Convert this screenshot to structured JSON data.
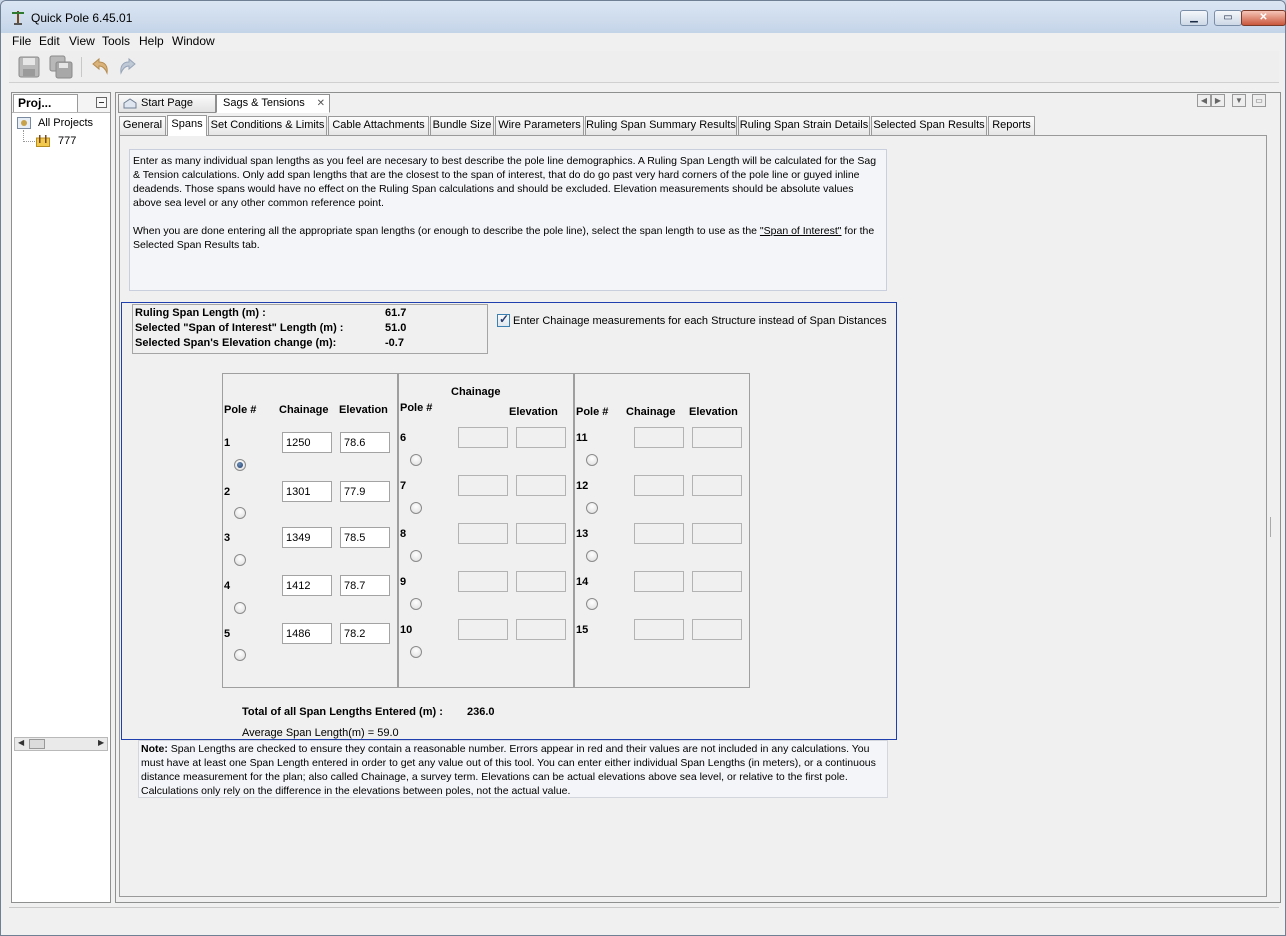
{
  "window": {
    "title": "Quick Pole 6.45.01"
  },
  "menu": [
    "File",
    "Edit",
    "View",
    "Tools",
    "Help",
    "Window"
  ],
  "projects_panel": {
    "tab_label": "Proj...",
    "tree": [
      {
        "label": "All Projects"
      },
      {
        "label": "777"
      }
    ]
  },
  "doc_tabs": [
    {
      "label": "Start Page"
    },
    {
      "label": "Sags & Tensions"
    }
  ],
  "sub_tabs": [
    "General",
    "Spans",
    "Set Conditions & Limits",
    "Cable Attachments",
    "Bundle Size",
    "Wire Parameters",
    "Ruling Span Summary Results",
    "Ruling Span Strain Details",
    "Selected Span Results",
    "Reports"
  ],
  "intro": {
    "para1": "Enter as many individual span lengths as you feel are necesary to best describe the pole line demographics. A Ruling Span Length will be calculated for the Sag & Tension calculations. Only add span lengths that are the closest to the span of interest, that do do go past very hard corners of the pole line or guyed inline deadends. Those spans would have no effect on the Ruling Span calculations and should be excluded. Elevation measurements should be absolute values above sea level or any other common reference point.",
    "para2_before": "When you are done entering all the appropriate span lengths (or enough to describe the pole line), select the span length to use as the ",
    "para2_link": "\"Span of Interest\"",
    "para2_after": " for the Selected Span Results tab."
  },
  "summary": {
    "ruling_label": "Ruling Span Length (m) :",
    "ruling_value": "61.7",
    "selected_label": "Selected \"Span of Interest\" Length (m) :",
    "selected_value": "51.0",
    "elev_label": "Selected Span's Elevation change (m):",
    "elev_value": "-0.7"
  },
  "chainage_checkbox": {
    "label": "Enter Chainage measurements for each Structure instead of Span Distances",
    "checked": true
  },
  "headers": {
    "pole": "Pole #",
    "chainage": "Chainage",
    "elevation": "Elevation"
  },
  "poles": [
    {
      "num": "1",
      "chainage": "1250",
      "elevation": "78.6",
      "selected": true
    },
    {
      "num": "2",
      "chainage": "1301",
      "elevation": "77.9"
    },
    {
      "num": "3",
      "chainage": "1349",
      "elevation": "78.5"
    },
    {
      "num": "4",
      "chainage": "1412",
      "elevation": "78.7"
    },
    {
      "num": "5",
      "chainage": "1486",
      "elevation": "78.2"
    },
    {
      "num": "6"
    },
    {
      "num": "7"
    },
    {
      "num": "8"
    },
    {
      "num": "9"
    },
    {
      "num": "10"
    },
    {
      "num": "11"
    },
    {
      "num": "12"
    },
    {
      "num": "13"
    },
    {
      "num": "14"
    },
    {
      "num": "15"
    }
  ],
  "totals": {
    "total_label": "Total of all Span Lengths Entered (m) :",
    "total_value": "236.0",
    "avg_text": "Average Span Length(m) =  59.0"
  },
  "note": {
    "bold": "Note:",
    "text": " Span Lengths are checked to ensure they contain a reasonable number. Errors appear in red and their values are not included in any calculations. You must have at least one Span Length entered in order to get any value out of this tool. You can enter either individual Span Lengths (in meters), or a continuous distance measurement for the plan; also called Chainage, a survey term. Elevations can be actual elevations above sea level, or relative to the first pole. Calculations only rely on the difference in the elevations between poles, not the actual value."
  }
}
